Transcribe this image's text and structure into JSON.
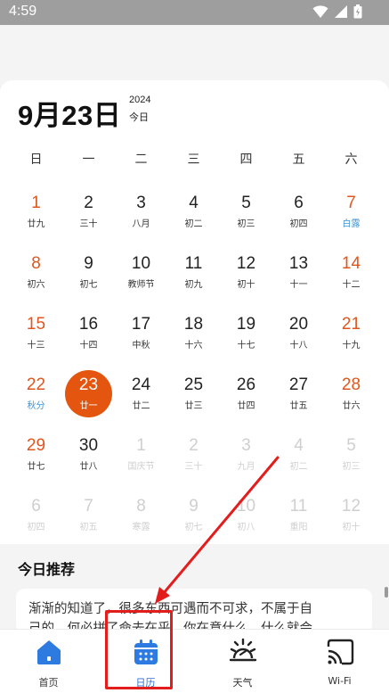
{
  "status_bar": {
    "time": "4:59"
  },
  "header": {
    "date_title": "9月23日",
    "year": "2024",
    "today_label": "今日"
  },
  "calendar": {
    "weekdays": [
      "日",
      "一",
      "二",
      "三",
      "四",
      "五",
      "六"
    ],
    "weeks": [
      [
        {
          "day": "1",
          "lunar": "廿九",
          "state": "weekend"
        },
        {
          "day": "2",
          "lunar": "三十",
          "state": "normal"
        },
        {
          "day": "3",
          "lunar": "八月",
          "state": "normal"
        },
        {
          "day": "4",
          "lunar": "初二",
          "state": "normal"
        },
        {
          "day": "5",
          "lunar": "初三",
          "state": "normal"
        },
        {
          "day": "6",
          "lunar": "初四",
          "state": "normal"
        },
        {
          "day": "7",
          "lunar": "白露",
          "state": "weekend festival"
        }
      ],
      [
        {
          "day": "8",
          "lunar": "初六",
          "state": "weekend"
        },
        {
          "day": "9",
          "lunar": "初七",
          "state": "normal"
        },
        {
          "day": "10",
          "lunar": "教师节",
          "state": "normal"
        },
        {
          "day": "11",
          "lunar": "初九",
          "state": "normal"
        },
        {
          "day": "12",
          "lunar": "初十",
          "state": "normal"
        },
        {
          "day": "13",
          "lunar": "十一",
          "state": "normal"
        },
        {
          "day": "14",
          "lunar": "十二",
          "state": "weekend"
        }
      ],
      [
        {
          "day": "15",
          "lunar": "十三",
          "state": "weekend"
        },
        {
          "day": "16",
          "lunar": "十四",
          "state": "normal"
        },
        {
          "day": "17",
          "lunar": "中秋",
          "state": "normal"
        },
        {
          "day": "18",
          "lunar": "十六",
          "state": "normal"
        },
        {
          "day": "19",
          "lunar": "十七",
          "state": "normal"
        },
        {
          "day": "20",
          "lunar": "十八",
          "state": "normal"
        },
        {
          "day": "21",
          "lunar": "十九",
          "state": "weekend"
        }
      ],
      [
        {
          "day": "22",
          "lunar": "秋分",
          "state": "weekend festival"
        },
        {
          "day": "23",
          "lunar": "廿一",
          "state": "selected"
        },
        {
          "day": "24",
          "lunar": "廿二",
          "state": "normal"
        },
        {
          "day": "25",
          "lunar": "廿三",
          "state": "normal"
        },
        {
          "day": "26",
          "lunar": "廿四",
          "state": "normal"
        },
        {
          "day": "27",
          "lunar": "廿五",
          "state": "normal"
        },
        {
          "day": "28",
          "lunar": "廿六",
          "state": "weekend"
        }
      ],
      [
        {
          "day": "29",
          "lunar": "廿七",
          "state": "weekend"
        },
        {
          "day": "30",
          "lunar": "廿八",
          "state": "normal"
        },
        {
          "day": "1",
          "lunar": "国庆节",
          "state": "other"
        },
        {
          "day": "2",
          "lunar": "三十",
          "state": "other"
        },
        {
          "day": "3",
          "lunar": "九月",
          "state": "other"
        },
        {
          "day": "4",
          "lunar": "初二",
          "state": "other"
        },
        {
          "day": "5",
          "lunar": "初三",
          "state": "other"
        }
      ],
      [
        {
          "day": "6",
          "lunar": "初四",
          "state": "other"
        },
        {
          "day": "7",
          "lunar": "初五",
          "state": "other"
        },
        {
          "day": "8",
          "lunar": "寒露",
          "state": "other"
        },
        {
          "day": "9",
          "lunar": "初七",
          "state": "other"
        },
        {
          "day": "10",
          "lunar": "初八",
          "state": "other"
        },
        {
          "day": "11",
          "lunar": "重阳",
          "state": "other"
        },
        {
          "day": "12",
          "lunar": "初十",
          "state": "other"
        }
      ]
    ]
  },
  "recommendation": {
    "title": "今日推荐",
    "line1": "渐渐的知道了，很多东西可遇而不可求，不属于自",
    "line2": "己的，何必拼了命去在乎。你在意什么，什么就会"
  },
  "bottom_nav": [
    {
      "label": "首页",
      "icon": "home-icon",
      "active": false
    },
    {
      "label": "日历",
      "icon": "calendar-icon",
      "active": true
    },
    {
      "label": "天气",
      "icon": "weather-icon",
      "active": false
    },
    {
      "label": "Wi-Fi",
      "icon": "wifi-cast-icon",
      "active": false
    }
  ],
  "colors": {
    "accent_orange": "#e4560f",
    "festival_blue": "#3a93d6",
    "nav_active_blue": "#2f6fd6",
    "annotation_red": "#e31c1c"
  }
}
